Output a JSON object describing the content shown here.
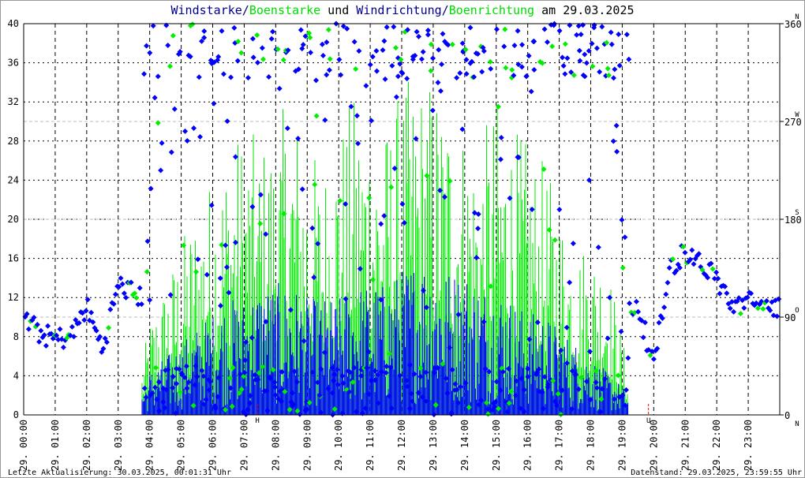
{
  "title": {
    "part1": "Windstarke",
    "sep1": "/",
    "part2": "Boenstarke",
    "mid": " und ",
    "part3": "Windrichtung",
    "sep2": "/",
    "part4": "Boenrichtung",
    "suffix": " am 29.03.2025"
  },
  "footer": {
    "left": "Letzte Aktualisierung: 30.03.2025, 00:01:31 Uhr",
    "right": "Datenstand: 29.03.2025, 23:59:55 Uhr"
  },
  "colors": {
    "wind": "#0000ff",
    "gust": "#00ee00",
    "title_blue": "#00008b",
    "title_green": "#00dd00",
    "marker": "#ff0000"
  },
  "chart_data": {
    "type": "line",
    "title": "Windstarke/Boenstarke und Windrichtung/Boenrichtung am 29.03.2025",
    "ylim": [
      0,
      40
    ],
    "y_ticks": [
      "0",
      "4",
      "8",
      "12",
      "16",
      "20",
      "24",
      "28",
      "32",
      "36",
      "40"
    ],
    "y2lim": [
      0,
      360
    ],
    "y2_ticks": [
      "0",
      "90",
      "180",
      "270",
      "360"
    ],
    "y2_compass": [
      "N",
      "O",
      "S",
      "W",
      "N"
    ],
    "x_ticks": [
      "29. 00:00",
      "29. 01:00",
      "29. 02:00",
      "29. 03:00",
      "29. 04:00",
      "29. 05:00",
      "29. 06:00",
      "29. 07:00",
      "29. 08:00",
      "29. 09:00",
      "29. 10:00",
      "29. 11:00",
      "29. 12:00",
      "29. 13:00",
      "29. 14:00",
      "29. 15:00",
      "29. 16:00",
      "29. 17:00",
      "29. 18:00",
      "29. 19:00",
      "29. 20:00",
      "29. 21:00",
      "29. 22:00",
      "29. 23:00"
    ],
    "grid": true,
    "x_hours_half": [
      0,
      0.5,
      1,
      1.5,
      2,
      2.5,
      3,
      3.5,
      4,
      4.5,
      5,
      5.5,
      6,
      6.5,
      7,
      7.5,
      8,
      8.5,
      9,
      9.5,
      10,
      10.5,
      11,
      11.5,
      12,
      12.5,
      13,
      13.5,
      14,
      14.5,
      15,
      15.5,
      16,
      16.5,
      17,
      17.5,
      18,
      18.5,
      19,
      19.5,
      20,
      20.5,
      21,
      21.5,
      22,
      22.5,
      23,
      23.5
    ],
    "series": [
      {
        "name": "Windstarke",
        "axis": "left",
        "values": [
          0,
          0,
          0,
          0,
          0,
          0,
          0,
          0,
          3,
          4,
          5,
          6,
          7,
          8,
          8,
          9,
          9,
          9,
          8,
          8,
          8,
          9,
          9,
          9,
          10,
          11,
          11,
          10,
          10,
          9,
          9,
          8,
          7,
          7,
          6,
          5,
          4,
          3,
          2,
          0,
          0,
          0,
          0,
          0,
          0,
          0,
          0,
          0
        ]
      },
      {
        "name": "Boenstarke",
        "axis": "left",
        "values": [
          0,
          0,
          0,
          0,
          0,
          0,
          0,
          0,
          10,
          14,
          18,
          22,
          25,
          28,
          30,
          28,
          30,
          33,
          28,
          26,
          30,
          33,
          32,
          30,
          34,
          35,
          35,
          33,
          30,
          28,
          33,
          30,
          28,
          26,
          22,
          18,
          18,
          17,
          8,
          0,
          0,
          0,
          0,
          0,
          0,
          0,
          0,
          0
        ]
      },
      {
        "name": "Windrichtung",
        "axis": "right",
        "values": [
          90,
          75,
          70,
          72,
          100,
          60,
          120,
          112,
          "var",
          "var",
          "var",
          "var",
          "var",
          "var",
          "var",
          "var",
          "var",
          "var",
          "var",
          "var",
          "var",
          "var",
          "var",
          "var",
          "var",
          "var",
          "var",
          "var",
          "var",
          "var",
          "var",
          "var",
          "var",
          "var",
          "var",
          "var",
          "var",
          "var",
          "var",
          100,
          45,
          135,
          150,
          140,
          125,
          100,
          104,
          100
        ]
      }
    ],
    "annotations": [
      {
        "label": "H",
        "time": "07:25"
      },
      {
        "label": "U",
        "time": "19:50"
      }
    ]
  }
}
